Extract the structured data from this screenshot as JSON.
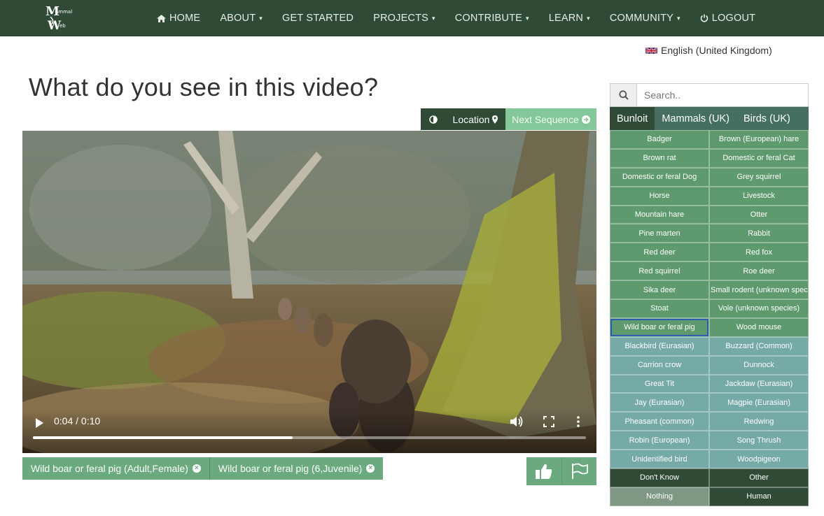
{
  "nav": {
    "items": [
      {
        "label": "HOME",
        "icon": "home-icon",
        "caret": false
      },
      {
        "label": "ABOUT",
        "caret": true
      },
      {
        "label": "GET STARTED",
        "caret": false
      },
      {
        "label": "PROJECTS",
        "caret": true
      },
      {
        "label": "CONTRIBUTE",
        "caret": true
      },
      {
        "label": "LEARN",
        "caret": true
      },
      {
        "label": "COMMUNITY",
        "caret": true
      },
      {
        "label": "LOGOUT",
        "icon": "power-icon",
        "caret": false
      }
    ]
  },
  "language": {
    "label": "English (United Kingdom)",
    "icon": "uk-flag-icon"
  },
  "page_title": "What do you see in this video?",
  "video_toolbar": {
    "contrast_icon": "contrast-icon",
    "location_label": "Location",
    "next_label": "Next Sequence"
  },
  "video": {
    "time": "0:04 / 0:10",
    "progress": 0.47
  },
  "tags": [
    {
      "label": "Wild boar or feral pig (Adult,Female)"
    },
    {
      "label": "Wild boar or feral pig (6,Juvenile)"
    }
  ],
  "actions": {
    "like_icon": "thumbs-up-icon",
    "flag_icon": "flag-icon"
  },
  "search": {
    "placeholder": "Search.."
  },
  "tabs": [
    {
      "label": "Bunloit",
      "active": true
    },
    {
      "label": "Mammals (UK)",
      "active": false
    },
    {
      "label": "Birds (UK)",
      "active": false
    }
  ],
  "species": [
    {
      "label": "Badger",
      "group": "mammal"
    },
    {
      "label": "Brown (European) hare",
      "group": "mammal"
    },
    {
      "label": "Brown rat",
      "group": "mammal"
    },
    {
      "label": "Domestic or feral Cat",
      "group": "mammal"
    },
    {
      "label": "Domestic or feral Dog",
      "group": "mammal"
    },
    {
      "label": "Grey squirrel",
      "group": "mammal"
    },
    {
      "label": "Horse",
      "group": "mammal"
    },
    {
      "label": "Livestock",
      "group": "mammal"
    },
    {
      "label": "Mountain hare",
      "group": "mammal"
    },
    {
      "label": "Otter",
      "group": "mammal"
    },
    {
      "label": "Pine marten",
      "group": "mammal"
    },
    {
      "label": "Rabbit",
      "group": "mammal"
    },
    {
      "label": "Red deer",
      "group": "mammal"
    },
    {
      "label": "Red fox",
      "group": "mammal"
    },
    {
      "label": "Red squirrel",
      "group": "mammal"
    },
    {
      "label": "Roe deer",
      "group": "mammal"
    },
    {
      "label": "Sika deer",
      "group": "mammal"
    },
    {
      "label": "Small rodent (unknown species)",
      "group": "mammal"
    },
    {
      "label": "Stoat",
      "group": "mammal"
    },
    {
      "label": "Vole (unknown species)",
      "group": "mammal"
    },
    {
      "label": "Wild boar or feral pig",
      "group": "mammal",
      "selected": true
    },
    {
      "label": "Wood mouse",
      "group": "mammal"
    },
    {
      "label": "Blackbird (Eurasian)",
      "group": "bird"
    },
    {
      "label": "Buzzard (Common)",
      "group": "bird"
    },
    {
      "label": "Carrion crow",
      "group": "bird"
    },
    {
      "label": "Dunnock",
      "group": "bird"
    },
    {
      "label": "Great Tit",
      "group": "bird"
    },
    {
      "label": "Jackdaw (Eurasian)",
      "group": "bird"
    },
    {
      "label": "Jay (Eurasian)",
      "group": "bird"
    },
    {
      "label": "Magpie (Eurasian)",
      "group": "bird"
    },
    {
      "label": "Pheasant (common)",
      "group": "bird"
    },
    {
      "label": "Redwing",
      "group": "bird"
    },
    {
      "label": "Robin (European)",
      "group": "bird"
    },
    {
      "label": "Song Thrush",
      "group": "bird"
    },
    {
      "label": "Unidentified bird",
      "group": "bird"
    },
    {
      "label": "Woodpigeon",
      "group": "bird"
    },
    {
      "label": "Don't Know",
      "group": "dark"
    },
    {
      "label": "Other",
      "group": "dark"
    },
    {
      "label": "Nothing",
      "group": "grey"
    },
    {
      "label": "Human",
      "group": "dark"
    }
  ],
  "colors": {
    "navbar": "#2f4b35",
    "mammal": "#5e9a6e",
    "bird": "#76aaa7",
    "next_button": "#82c898",
    "tag": "#6aaa7e"
  }
}
